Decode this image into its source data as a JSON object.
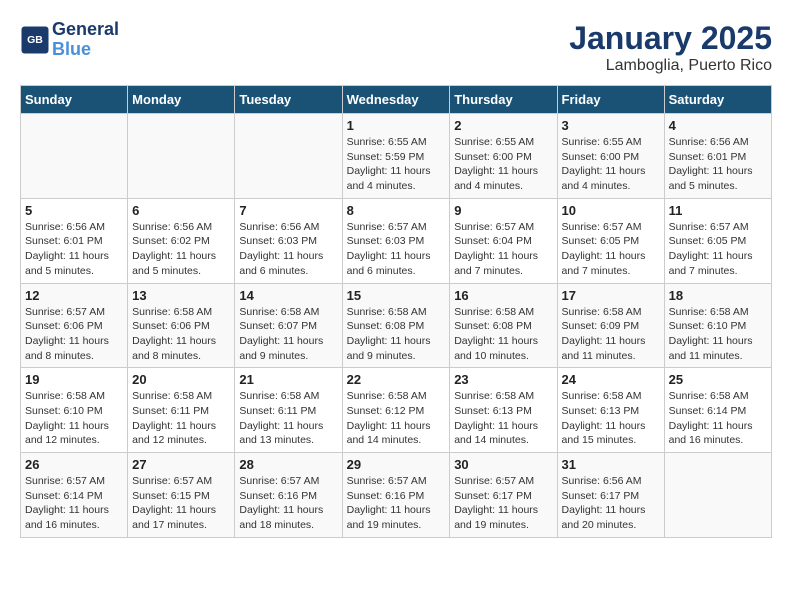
{
  "header": {
    "logo_line1": "General",
    "logo_line2": "Blue",
    "title": "January 2025",
    "subtitle": "Lamboglia, Puerto Rico"
  },
  "weekdays": [
    "Sunday",
    "Monday",
    "Tuesday",
    "Wednesday",
    "Thursday",
    "Friday",
    "Saturday"
  ],
  "weeks": [
    [
      {
        "day": "",
        "info": ""
      },
      {
        "day": "",
        "info": ""
      },
      {
        "day": "",
        "info": ""
      },
      {
        "day": "1",
        "info": "Sunrise: 6:55 AM\nSunset: 5:59 PM\nDaylight: 11 hours and 4 minutes."
      },
      {
        "day": "2",
        "info": "Sunrise: 6:55 AM\nSunset: 6:00 PM\nDaylight: 11 hours and 4 minutes."
      },
      {
        "day": "3",
        "info": "Sunrise: 6:55 AM\nSunset: 6:00 PM\nDaylight: 11 hours and 4 minutes."
      },
      {
        "day": "4",
        "info": "Sunrise: 6:56 AM\nSunset: 6:01 PM\nDaylight: 11 hours and 5 minutes."
      }
    ],
    [
      {
        "day": "5",
        "info": "Sunrise: 6:56 AM\nSunset: 6:01 PM\nDaylight: 11 hours and 5 minutes."
      },
      {
        "day": "6",
        "info": "Sunrise: 6:56 AM\nSunset: 6:02 PM\nDaylight: 11 hours and 5 minutes."
      },
      {
        "day": "7",
        "info": "Sunrise: 6:56 AM\nSunset: 6:03 PM\nDaylight: 11 hours and 6 minutes."
      },
      {
        "day": "8",
        "info": "Sunrise: 6:57 AM\nSunset: 6:03 PM\nDaylight: 11 hours and 6 minutes."
      },
      {
        "day": "9",
        "info": "Sunrise: 6:57 AM\nSunset: 6:04 PM\nDaylight: 11 hours and 7 minutes."
      },
      {
        "day": "10",
        "info": "Sunrise: 6:57 AM\nSunset: 6:05 PM\nDaylight: 11 hours and 7 minutes."
      },
      {
        "day": "11",
        "info": "Sunrise: 6:57 AM\nSunset: 6:05 PM\nDaylight: 11 hours and 7 minutes."
      }
    ],
    [
      {
        "day": "12",
        "info": "Sunrise: 6:57 AM\nSunset: 6:06 PM\nDaylight: 11 hours and 8 minutes."
      },
      {
        "day": "13",
        "info": "Sunrise: 6:58 AM\nSunset: 6:06 PM\nDaylight: 11 hours and 8 minutes."
      },
      {
        "day": "14",
        "info": "Sunrise: 6:58 AM\nSunset: 6:07 PM\nDaylight: 11 hours and 9 minutes."
      },
      {
        "day": "15",
        "info": "Sunrise: 6:58 AM\nSunset: 6:08 PM\nDaylight: 11 hours and 9 minutes."
      },
      {
        "day": "16",
        "info": "Sunrise: 6:58 AM\nSunset: 6:08 PM\nDaylight: 11 hours and 10 minutes."
      },
      {
        "day": "17",
        "info": "Sunrise: 6:58 AM\nSunset: 6:09 PM\nDaylight: 11 hours and 11 minutes."
      },
      {
        "day": "18",
        "info": "Sunrise: 6:58 AM\nSunset: 6:10 PM\nDaylight: 11 hours and 11 minutes."
      }
    ],
    [
      {
        "day": "19",
        "info": "Sunrise: 6:58 AM\nSunset: 6:10 PM\nDaylight: 11 hours and 12 minutes."
      },
      {
        "day": "20",
        "info": "Sunrise: 6:58 AM\nSunset: 6:11 PM\nDaylight: 11 hours and 12 minutes."
      },
      {
        "day": "21",
        "info": "Sunrise: 6:58 AM\nSunset: 6:11 PM\nDaylight: 11 hours and 13 minutes."
      },
      {
        "day": "22",
        "info": "Sunrise: 6:58 AM\nSunset: 6:12 PM\nDaylight: 11 hours and 14 minutes."
      },
      {
        "day": "23",
        "info": "Sunrise: 6:58 AM\nSunset: 6:13 PM\nDaylight: 11 hours and 14 minutes."
      },
      {
        "day": "24",
        "info": "Sunrise: 6:58 AM\nSunset: 6:13 PM\nDaylight: 11 hours and 15 minutes."
      },
      {
        "day": "25",
        "info": "Sunrise: 6:58 AM\nSunset: 6:14 PM\nDaylight: 11 hours and 16 minutes."
      }
    ],
    [
      {
        "day": "26",
        "info": "Sunrise: 6:57 AM\nSunset: 6:14 PM\nDaylight: 11 hours and 16 minutes."
      },
      {
        "day": "27",
        "info": "Sunrise: 6:57 AM\nSunset: 6:15 PM\nDaylight: 11 hours and 17 minutes."
      },
      {
        "day": "28",
        "info": "Sunrise: 6:57 AM\nSunset: 6:16 PM\nDaylight: 11 hours and 18 minutes."
      },
      {
        "day": "29",
        "info": "Sunrise: 6:57 AM\nSunset: 6:16 PM\nDaylight: 11 hours and 19 minutes."
      },
      {
        "day": "30",
        "info": "Sunrise: 6:57 AM\nSunset: 6:17 PM\nDaylight: 11 hours and 19 minutes."
      },
      {
        "day": "31",
        "info": "Sunrise: 6:56 AM\nSunset: 6:17 PM\nDaylight: 11 hours and 20 minutes."
      },
      {
        "day": "",
        "info": ""
      }
    ]
  ]
}
